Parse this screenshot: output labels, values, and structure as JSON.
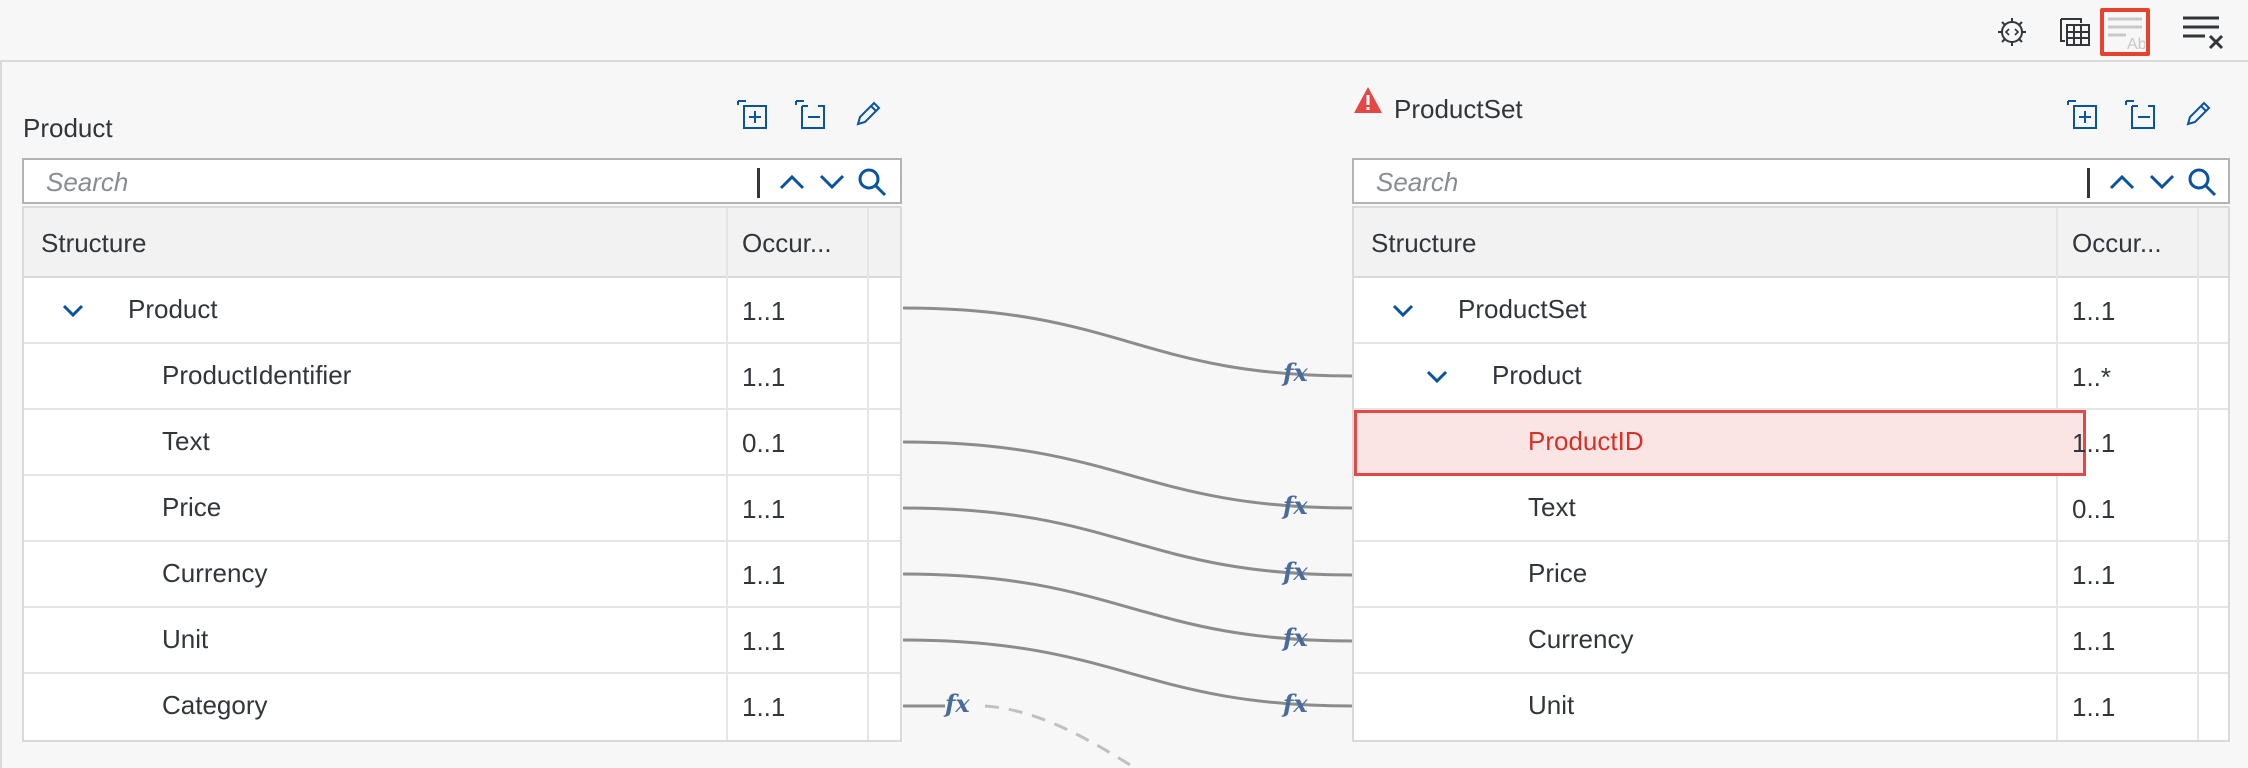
{
  "toolbar": {
    "icons": [
      "gear-code-icon",
      "table-calc-icon",
      "show-text-icon",
      "clear-mappings-icon"
    ],
    "active_icon": "show-text-icon"
  },
  "left": {
    "title": "Product",
    "search_placeholder": "Search",
    "col_structure": "Structure",
    "col_occurrence": "Occur...",
    "rows": [
      {
        "label": "Product",
        "occ": "1..1",
        "expandable": true
      },
      {
        "label": "ProductIdentifier",
        "occ": "1..1"
      },
      {
        "label": "Text",
        "occ": "0..1"
      },
      {
        "label": "Price",
        "occ": "1..1"
      },
      {
        "label": "Currency",
        "occ": "1..1"
      },
      {
        "label": "Unit",
        "occ": "1..1"
      },
      {
        "label": "Category",
        "occ": "1..1"
      }
    ]
  },
  "right": {
    "title": "ProductSet",
    "warning": true,
    "search_placeholder": "Search",
    "col_structure": "Structure",
    "col_occurrence": "Occur...",
    "rows": [
      {
        "label": "ProductSet",
        "occ": "1..1",
        "expandable": true
      },
      {
        "label": "Product",
        "occ": "1..*",
        "expandable": true
      },
      {
        "label": "ProductID",
        "occ": "1..1",
        "error": true
      },
      {
        "label": "Text",
        "occ": "0..1"
      },
      {
        "label": "Price",
        "occ": "1..1"
      },
      {
        "label": "Currency",
        "occ": "1..1"
      },
      {
        "label": "Unit",
        "occ": "1..1"
      }
    ]
  },
  "mapping": {
    "function_label": "fx"
  },
  "colors": {
    "accent": "#0a6ed1",
    "icon_blue": "#0854a0",
    "error": "#e34846",
    "error_bg": "#fbe4e4",
    "line": "#8c8c8c"
  }
}
